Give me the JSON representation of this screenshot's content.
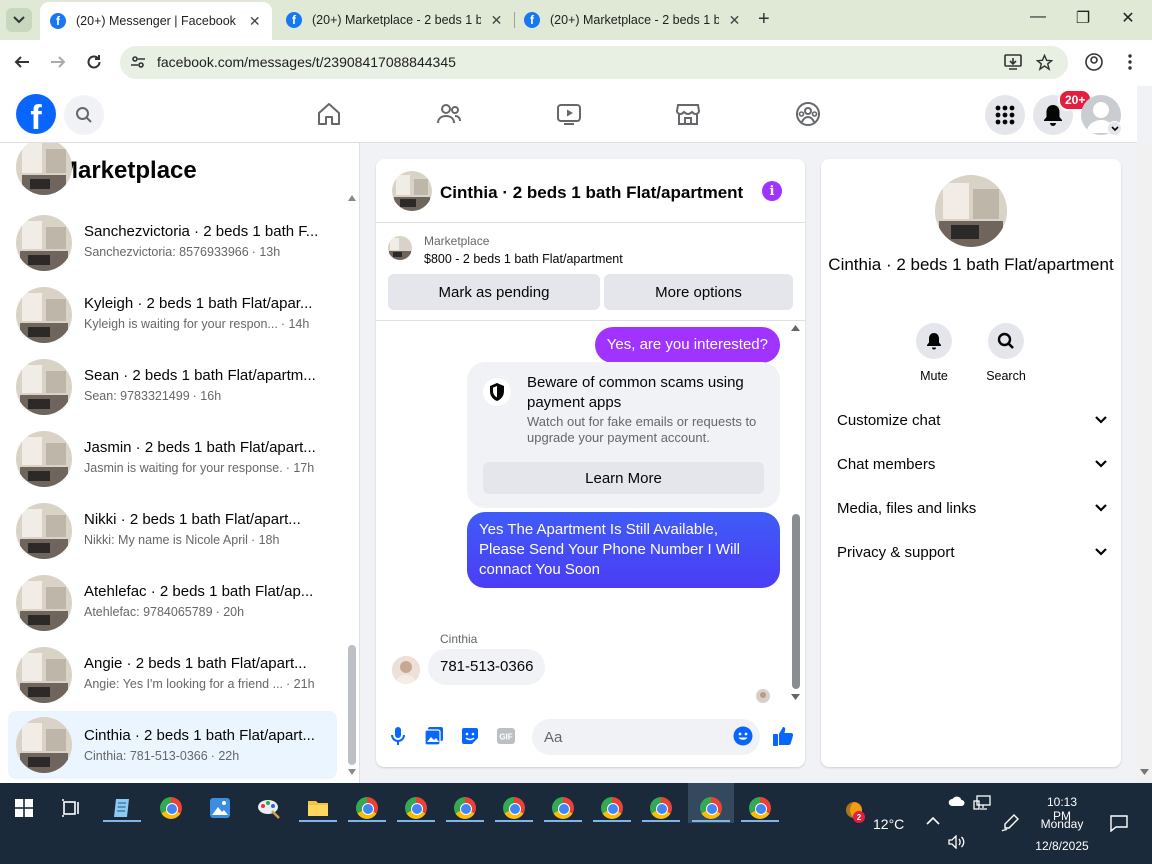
{
  "browser": {
    "tabs": [
      {
        "title": "(20+) Messenger | Facebook",
        "active": true
      },
      {
        "title": "(20+) Marketplace - 2 beds 1 b",
        "active": false
      },
      {
        "title": "(20+) Marketplace - 2 beds 1 b",
        "active": false
      }
    ],
    "url": "facebook.com/messages/t/23908417088844345"
  },
  "fb": {
    "logo_letter": "f",
    "notif_badge": "20+"
  },
  "left": {
    "title": "Marketplace",
    "conversations": [
      {
        "name": "Sanchezvictoria · 2 beds 1 bath F...",
        "preview": "Sanchezvictoria: 8576933966",
        "time": "· 13h"
      },
      {
        "name": "Kyleigh · 2 beds 1 bath Flat/apar...",
        "preview": "Kyleigh is waiting for your respon...",
        "time": "· 14h"
      },
      {
        "name": "Sean · 2 beds 1 bath Flat/apartm...",
        "preview": "Sean: 9783321499",
        "time": "· 16h"
      },
      {
        "name": "Jasmin · 2 beds 1 bath Flat/apart...",
        "preview": "Jasmin is waiting for your response.",
        "time": "· 17h"
      },
      {
        "name": "Nikki · 2 beds 1 bath Flat/apart...",
        "preview": "Nikki: My name is Nicole April",
        "time": "· 18h"
      },
      {
        "name": "Atehlefac · 2 beds 1 bath Flat/ap...",
        "preview": "Atehlefac: 9784065789",
        "time": "· 20h"
      },
      {
        "name": "Angie · 2 beds 1 bath Flat/apart...",
        "preview": "Angie: Yes I'm looking for a friend ...",
        "time": "· 21h"
      },
      {
        "name": "Cinthia · 2 beds 1 bath Flat/apart...",
        "preview": "Cinthia: 781-513-0366",
        "time": "· 22h"
      }
    ]
  },
  "chat": {
    "title": "Cinthia · 2 beds 1 bath Flat/apartment",
    "listing_source": "Marketplace",
    "listing_desc": "$800 - 2 beds 1 bath Flat/apartment",
    "mark_pending": "Mark as pending",
    "more_options": "More options",
    "msg_out_1": "Yes, are you interested?",
    "warning_title": "Beware of common scams using payment apps",
    "warning_body": "Watch out for fake emails or requests to upgrade your payment account.",
    "warning_button": "Learn More",
    "msg_out_2": "Yes The Apartment Is Still Available, Please Send Your Phone Number I Will connact You Soon",
    "sender_name": "Cinthia",
    "msg_in_1": "781-513-0366",
    "composer_placeholder": "Aa"
  },
  "right": {
    "name": "Cinthia · 2 beds 1 bath Flat/apartment",
    "actions": [
      {
        "label": "Mute"
      },
      {
        "label": "Search"
      }
    ],
    "sections": [
      "Customize chat",
      "Chat members",
      "Media, files and links",
      "Privacy & support"
    ]
  },
  "taskbar": {
    "temperature": "12°C",
    "weather_badge": "2",
    "time": "10:13 PM",
    "day": "Monday",
    "date": "12/8/2025"
  },
  "colors": {
    "fb_blue": "#0866ff",
    "messenger_purple": "#a033ff",
    "messenger_blue": "#4b3df5",
    "selected_row": "#ebf5ff"
  }
}
